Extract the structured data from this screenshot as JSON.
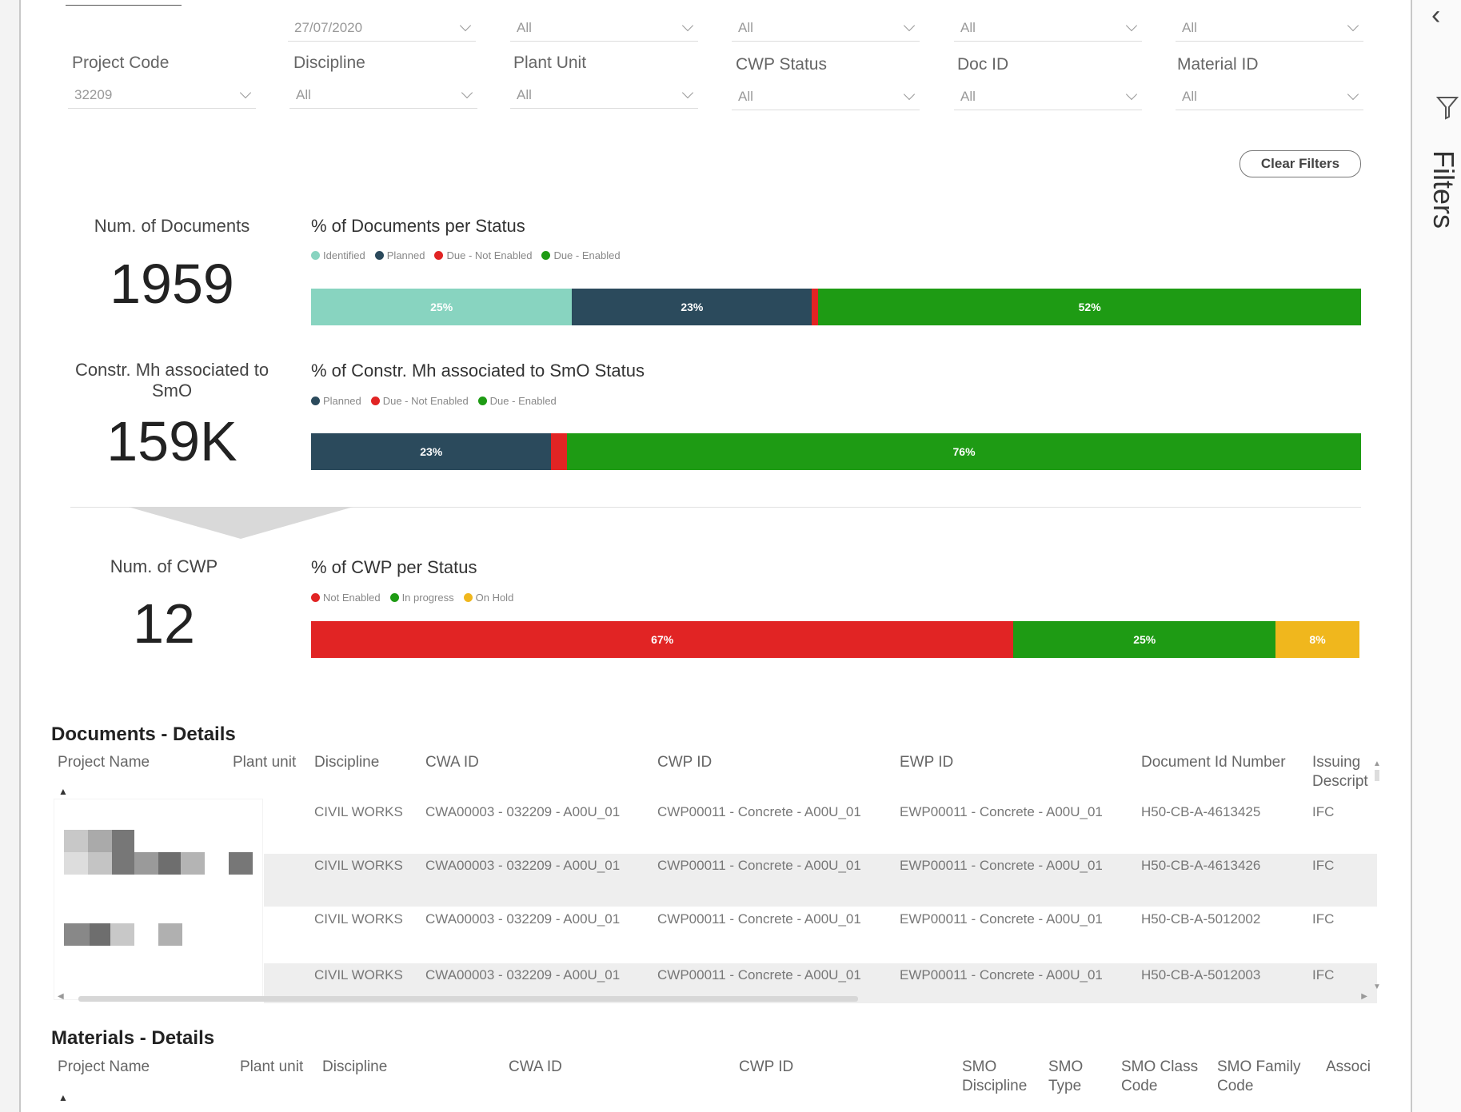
{
  "filters_pane": {
    "label": "Filters"
  },
  "slicers_top_row": [
    {
      "value": ""
    },
    {
      "value": "27/07/2020"
    },
    {
      "value": "All"
    },
    {
      "value": "All"
    },
    {
      "value": "All"
    },
    {
      "value": "All"
    }
  ],
  "slicers_second_row": [
    {
      "label": "Project Code",
      "value": "32209"
    },
    {
      "label": "Discipline",
      "value": "All"
    },
    {
      "label": "Plant Unit",
      "value": "All"
    },
    {
      "label": "CWP Status",
      "value": "All"
    },
    {
      "label": "Doc ID",
      "value": "All"
    },
    {
      "label": "Material ID",
      "value": "All"
    }
  ],
  "clear_filters_label": "Clear Filters",
  "kpis": {
    "documents": {
      "label": "Num. of Documents",
      "value": "1959"
    },
    "constr_mh": {
      "label": "Constr. Mh associated to SmO",
      "value": "159K"
    },
    "cwp": {
      "label": "Num. of CWP",
      "value": "12"
    }
  },
  "colors": {
    "identified": "#88d4c0",
    "planned": "#2b4a5c",
    "due_not_enabled": "#e12424",
    "due_enabled": "#1e9b14",
    "on_hold": "#f0b71d"
  },
  "chart_data": [
    {
      "type": "bar",
      "orientation": "horizontal-stacked-100",
      "title": "% of Documents per Status",
      "series": [
        {
          "name": "Identified",
          "value": 25,
          "label": "25%"
        },
        {
          "name": "Planned",
          "value": 23,
          "label": "23%"
        },
        {
          "name": "Due - Not Enabled",
          "value": 0.6,
          "label": ""
        },
        {
          "name": "Due - Enabled",
          "value": 52,
          "label": "52%"
        }
      ],
      "legend": "top-left"
    },
    {
      "type": "bar",
      "orientation": "horizontal-stacked-100",
      "title": "% of Constr. Mh associated to SmO Status",
      "series": [
        {
          "name": "Planned",
          "value": 23,
          "label": "23%"
        },
        {
          "name": "Due - Not Enabled",
          "value": 1.5,
          "label": ""
        },
        {
          "name": "Due - Enabled",
          "value": 76,
          "label": "76%"
        }
      ],
      "legend": "top-left"
    },
    {
      "type": "bar",
      "orientation": "horizontal-stacked-100",
      "title": "% of CWP per Status",
      "series": [
        {
          "name": "Not Enabled",
          "value": 67,
          "label": "67%"
        },
        {
          "name": "In progress",
          "value": 25,
          "label": "25%"
        },
        {
          "name": "On Hold",
          "value": 8,
          "label": "8%"
        }
      ],
      "legend": "top-left"
    }
  ],
  "documents_details": {
    "title": "Documents - Details",
    "columns": [
      "Project Name",
      "Plant unit",
      "Discipline",
      "CWA ID",
      "CWP ID",
      "EWP ID",
      "Document Id Number",
      "Issuing Descript"
    ],
    "rows": [
      [
        "CIVIL WORKS",
        "CWA00003 - 032209 - A00U_01",
        "CWP00011 - Concrete - A00U_01",
        "EWP00011 - Concrete - A00U_01",
        "H50-CB-A-4613425",
        "IFC"
      ],
      [
        "CIVIL WORKS",
        "CWA00003 - 032209 - A00U_01",
        "CWP00011 - Concrete - A00U_01",
        "EWP00011 - Concrete - A00U_01",
        "H50-CB-A-4613426",
        "IFC"
      ],
      [
        "CIVIL WORKS",
        "CWA00003 - 032209 - A00U_01",
        "CWP00011 - Concrete - A00U_01",
        "EWP00011 - Concrete - A00U_01",
        "H50-CB-A-5012002",
        "IFC"
      ],
      [
        "CIVIL WORKS",
        "CWA00003 - 032209 - A00U_01",
        "CWP00011 - Concrete - A00U_01",
        "EWP00011 - Concrete - A00U_01",
        "H50-CB-A-5012003",
        "IFC"
      ]
    ]
  },
  "materials_details": {
    "title": "Materials - Details",
    "columns": [
      "Project Name",
      "Plant unit",
      "Discipline",
      "CWA ID",
      "CWP ID",
      "SMO Discipline",
      "SMO Type",
      "SMO Class Code",
      "SMO Family Code",
      "Associ"
    ]
  }
}
